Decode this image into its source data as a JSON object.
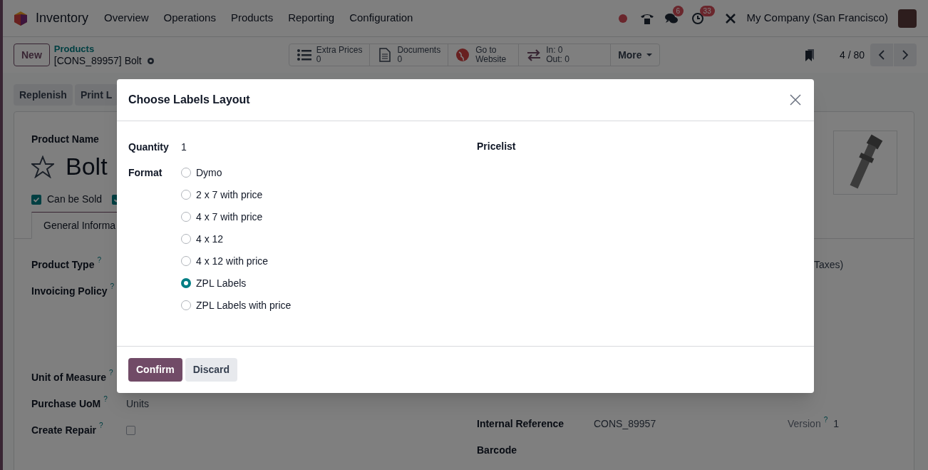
{
  "navbar": {
    "app": "Inventory",
    "menu": [
      "Overview",
      "Operations",
      "Products",
      "Reporting",
      "Configuration"
    ],
    "chat_count": "6",
    "activity_count": "33",
    "company": "My Company (San Francisco)"
  },
  "control_panel": {
    "new_button": "New",
    "breadcrumb": "Products",
    "record": "[CONS_89957] Bolt",
    "smart_buttons": [
      {
        "kind": "stat",
        "label": "Extra Prices",
        "value": "0"
      },
      {
        "kind": "stat",
        "label": "Documents",
        "value": "0"
      },
      {
        "kind": "link",
        "label": "Go to Website"
      },
      {
        "kind": "inout",
        "in_label": "In:",
        "in_value": "0",
        "out_label": "Out:",
        "out_value": "0"
      },
      {
        "kind": "more",
        "label": "More"
      }
    ],
    "pager": "4 / 80"
  },
  "actions": [
    "Replenish",
    "Print L"
  ],
  "form": {
    "name_label": "Product Name",
    "name": "Bolt",
    "favorite": false,
    "checkboxes": [
      {
        "label": "Can be Sold",
        "checked": true
      },
      {
        "checked": true
      }
    ],
    "tabs": [
      {
        "label": "General Informa",
        "selected": true
      }
    ],
    "left_fields": [
      {
        "label": "Product Type",
        "help": "?"
      },
      {
        "label": "Invoicing Policy",
        "help": "?"
      },
      {
        "label": "Unit of Measure",
        "help": "?"
      },
      {
        "label": "Purchase UoM",
        "help": "?",
        "value": "Units"
      },
      {
        "label": "Create Repair",
        "help": "?",
        "checkbox": false
      }
    ],
    "right_fragment": "Taxes)",
    "right_fields": [
      {
        "label": "Internal Reference",
        "value": "CONS_89957",
        "extra_label": "Version",
        "extra_help": "?",
        "extra_value": "1"
      },
      {
        "label": "Barcode"
      }
    ]
  },
  "dialog": {
    "title": "Choose Labels Layout",
    "quantity_label": "Quantity",
    "quantity": "1",
    "format_label": "Format",
    "pricelist_label": "Pricelist",
    "formats": [
      {
        "label": "Dymo",
        "selected": false
      },
      {
        "label": "2 x 7 with price",
        "selected": false
      },
      {
        "label": "4 x 7 with price",
        "selected": false
      },
      {
        "label": "4 x 12",
        "selected": false
      },
      {
        "label": "4 x 12 with price",
        "selected": false
      },
      {
        "label": "ZPL Labels",
        "selected": true
      },
      {
        "label": "ZPL Labels with price",
        "selected": false
      }
    ],
    "confirm": "Confirm",
    "discard": "Discard"
  }
}
